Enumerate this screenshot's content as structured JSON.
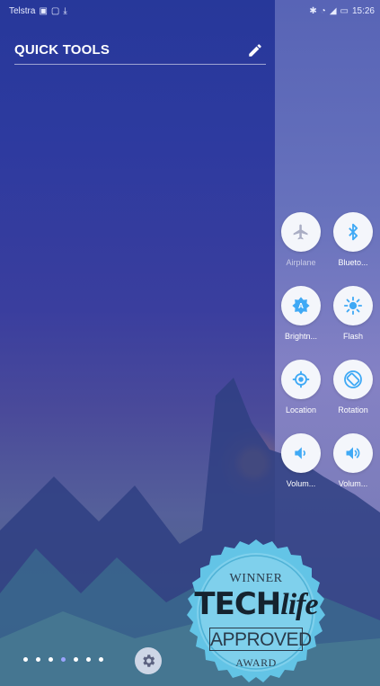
{
  "status_bar": {
    "carrier": "Telstra",
    "time": "15:26"
  },
  "quick_tools": {
    "title": "QUICK TOOLS",
    "edit_icon": "pencil-icon"
  },
  "tools": [
    {
      "label": "Airplane",
      "icon": "airplane-icon",
      "state": "off"
    },
    {
      "label": "Blueto...",
      "icon": "bluetooth-icon",
      "state": "on"
    },
    {
      "label": "Brightn...",
      "icon": "brightness-icon",
      "state": "on"
    },
    {
      "label": "Flash",
      "icon": "flash-icon",
      "state": "on"
    },
    {
      "label": "Location",
      "icon": "location-icon",
      "state": "on"
    },
    {
      "label": "Rotation",
      "icon": "rotation-icon",
      "state": "on"
    },
    {
      "label": "Volum...",
      "icon": "volume-down-icon",
      "state": "on"
    },
    {
      "label": "Volum...",
      "icon": "volume-up-icon",
      "state": "on"
    }
  ],
  "pager": {
    "page_count": 7,
    "active_page": 3
  },
  "settings_icon": "gear-icon",
  "badge": {
    "winner": "WINNER",
    "brand_tech": "TECH",
    "brand_life": "life",
    "approved": "APPROVED",
    "award": "AWARD"
  },
  "colors": {
    "accent": "#3fa9f5",
    "tool_background": "#f4f6fb",
    "badge": "#63c4e6"
  }
}
